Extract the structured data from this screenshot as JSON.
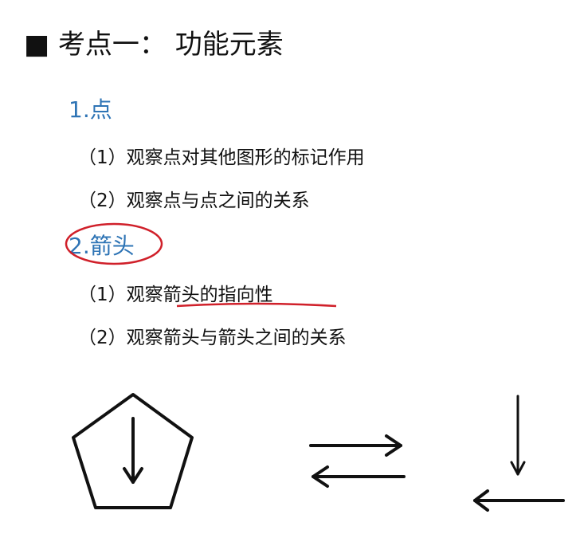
{
  "title": {
    "bullet": "■",
    "text": "考点一：  功能元素"
  },
  "sections": [
    {
      "heading": "1.点",
      "items": [
        "（1）观察点对其他图形的标记作用",
        "（2）观察点与点之间的关系"
      ]
    },
    {
      "heading": "2.箭头",
      "items": [
        "（1）观察箭头的指向性",
        "（2）观察箭头与箭头之间的关系"
      ]
    }
  ],
  "annotation_color": "#d0202a",
  "heading_color": "#2e74b5"
}
